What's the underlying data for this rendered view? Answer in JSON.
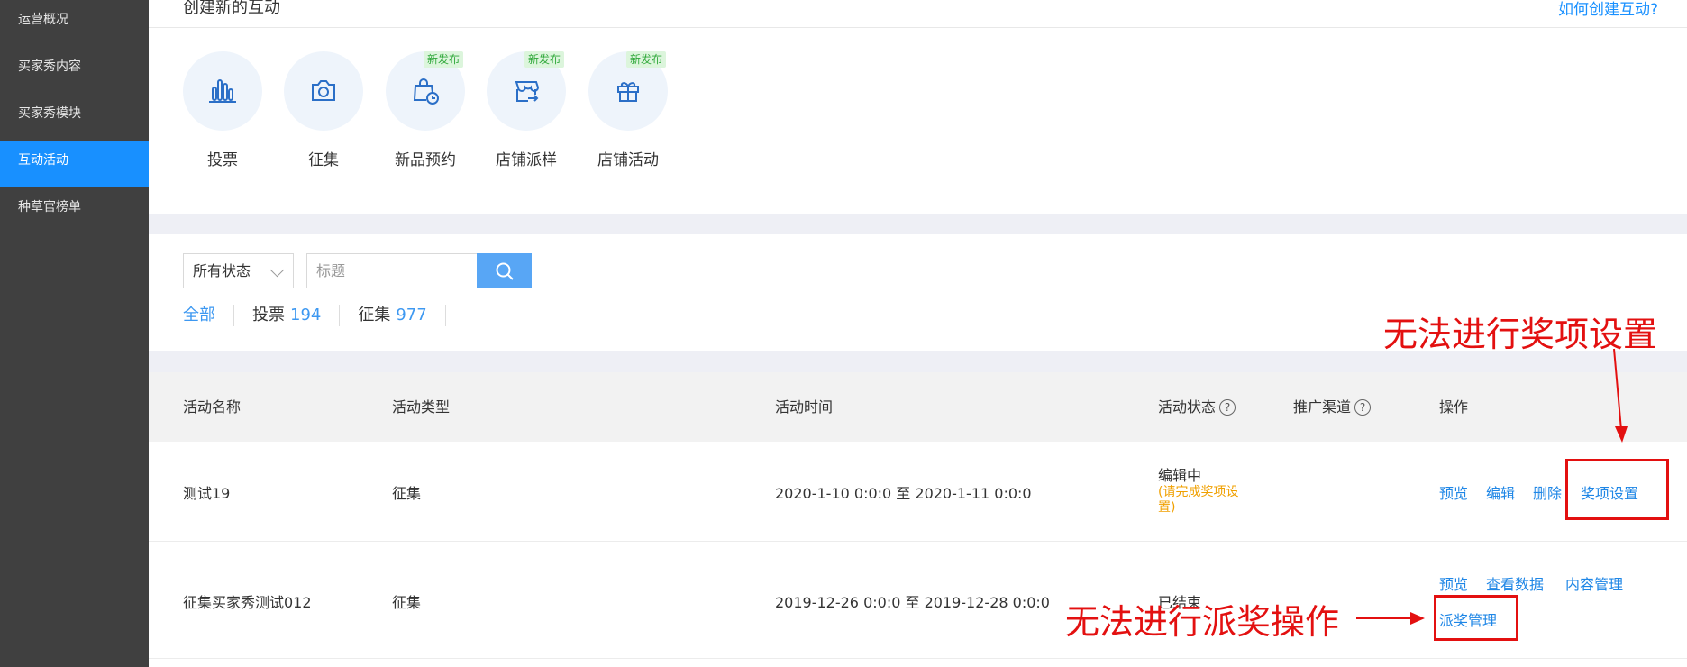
{
  "sidebar": {
    "items": [
      {
        "label": "运营概况"
      },
      {
        "label": "买家秀内容"
      },
      {
        "label": "买家秀模块"
      },
      {
        "label": "互动活动",
        "active": true
      },
      {
        "label": "种草官榜单"
      }
    ]
  },
  "header": {
    "title": "创建新的互动",
    "help_link": "如何创建互动?"
  },
  "activity_types": [
    {
      "label": "投票",
      "icon": "bar-chart-icon",
      "badge": ""
    },
    {
      "label": "征集",
      "icon": "camera-icon",
      "badge": ""
    },
    {
      "label": "新品预约",
      "icon": "shopping-bag-clock-icon",
      "badge": "新发布"
    },
    {
      "label": "店铺派样",
      "icon": "storefront-arrow-icon",
      "badge": "新发布"
    },
    {
      "label": "店铺活动",
      "icon": "gift-icon",
      "badge": "新发布"
    }
  ],
  "filters": {
    "status_select": "所有状态",
    "search_placeholder": "标题"
  },
  "tabs": [
    {
      "label": "全部",
      "count": "",
      "active": true
    },
    {
      "label": "投票",
      "count": "194"
    },
    {
      "label": "征集",
      "count": "977"
    }
  ],
  "table": {
    "headers": {
      "name": "活动名称",
      "type": "活动类型",
      "time": "活动时间",
      "status": "活动状态",
      "channel": "推广渠道",
      "ops": "操作"
    },
    "rows": [
      {
        "name": "测试19",
        "type": "征集",
        "time": "2020-1-10 0:0:0 至 2020-1-11 0:0:0",
        "status": "编辑中",
        "status_note_line1": "(请完成奖项设",
        "status_note_line2": "置)",
        "ops": [
          "预览",
          "编辑",
          "删除",
          "奖项设置"
        ]
      },
      {
        "name": "征集买家秀测试012",
        "type": "征集",
        "time": "2019-12-26 0:0:0 至 2019-12-28 0:0:0",
        "status": "已结束",
        "ops": [
          "预览",
          "查看数据",
          "内容管理",
          "派奖管理"
        ]
      }
    ]
  },
  "annotations": {
    "top": "无法进行奖项设置",
    "bottom": "无法进行派奖操作"
  },
  "colors": {
    "accent": "#1890ff",
    "sidebar_bg": "#404040",
    "annotation_red": "#e31010",
    "warn": "#f0a000"
  }
}
